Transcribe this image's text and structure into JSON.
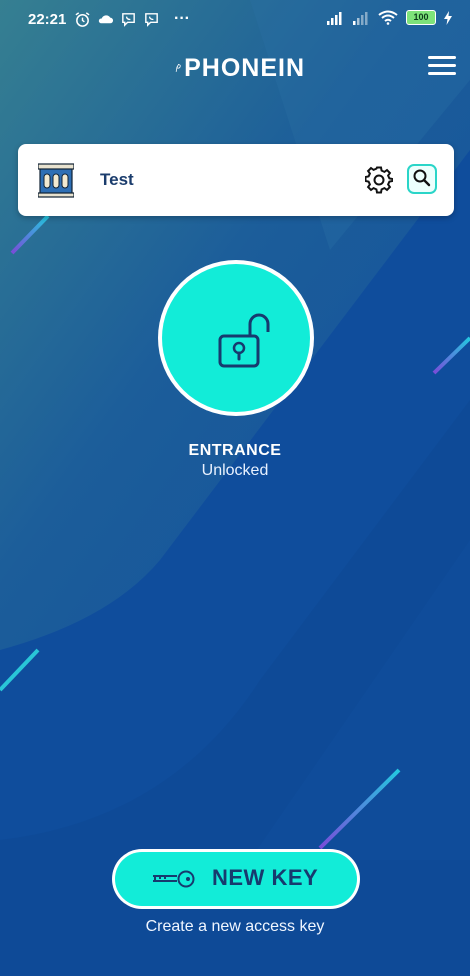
{
  "status_bar": {
    "time": "22:21",
    "left_icons": [
      "alarm-icon",
      "cloud-icon",
      "viber-icon",
      "viber-icon",
      "more-dots-icon"
    ],
    "right_icons": [
      "signal-icon",
      "signal-icon",
      "wifi-icon",
      "battery-icon",
      "charging-icon"
    ],
    "battery": "100",
    "more": "···"
  },
  "header": {
    "brand": "PHONEIN",
    "menu_icon": "hamburger-icon"
  },
  "site_card": {
    "name": "Test",
    "icon": "building-icon",
    "settings_icon": "gear-icon",
    "search_icon": "search-icon"
  },
  "door": {
    "name": "ENTRANCE",
    "status": "Unlocked",
    "icon": "unlocked-padlock-icon"
  },
  "new_key": {
    "label": "NEW KEY",
    "caption": "Create a new access key",
    "icon": "key-icon"
  },
  "colors": {
    "accent": "#12ecd8",
    "background_top": "#2f7a96",
    "background": "#0f4d9c",
    "text_dark": "#173a6e"
  }
}
